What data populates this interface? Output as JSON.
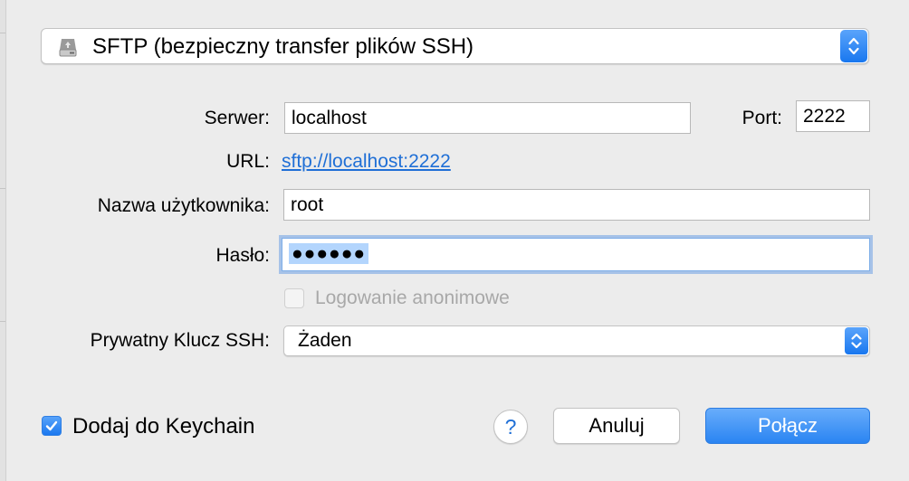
{
  "protocol": {
    "label": "SFTP (bezpieczny transfer plików SSH)",
    "icon": "network-drive-icon"
  },
  "server": {
    "label": "Serwer:",
    "value": "localhost"
  },
  "port": {
    "label": "Port:",
    "value": "2222"
  },
  "url": {
    "label": "URL:",
    "value": "sftp://localhost:2222"
  },
  "username": {
    "label": "Nazwa użytkownika:",
    "value": "root"
  },
  "password": {
    "label": "Hasło:",
    "masked_value": "●●●●●●"
  },
  "anonymous_login": {
    "label": "Logowanie anonimowe",
    "checked": false,
    "enabled": false
  },
  "ssh_key": {
    "label": "Prywatny Klucz SSH:",
    "value": "Żaden"
  },
  "keychain": {
    "label": "Dodaj do Keychain",
    "checked": true
  },
  "help": {
    "label": "?"
  },
  "buttons": {
    "cancel": "Anuluj",
    "connect": "Połącz"
  },
  "colors": {
    "accent": "#1b78ef",
    "link": "#1f6fd6",
    "background": "#ececec"
  }
}
